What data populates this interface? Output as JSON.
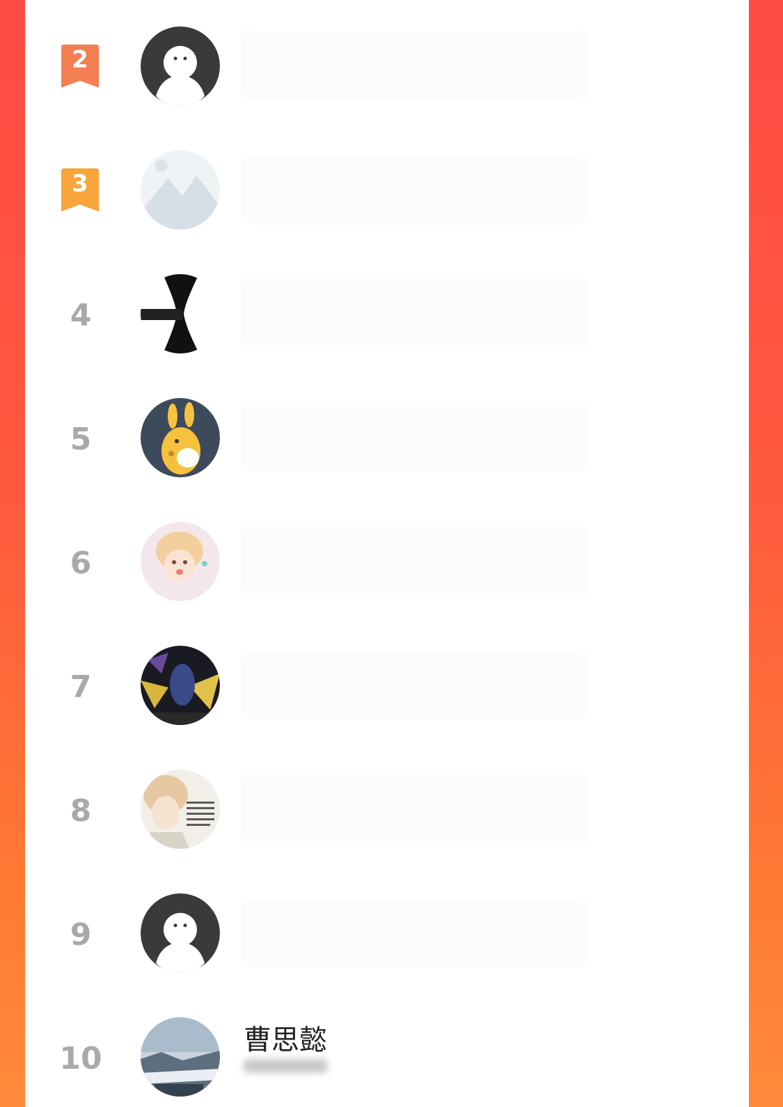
{
  "rows": [
    {
      "rank": "2",
      "badge_color": "#f47f52"
    },
    {
      "rank": "3",
      "badge_color": "#f7a53a"
    },
    {
      "rank": "4"
    },
    {
      "rank": "5"
    },
    {
      "rank": "6"
    },
    {
      "rank": "7"
    },
    {
      "rank": "8"
    },
    {
      "rank": "9"
    },
    {
      "rank": "10",
      "name": "曹思懿"
    }
  ]
}
